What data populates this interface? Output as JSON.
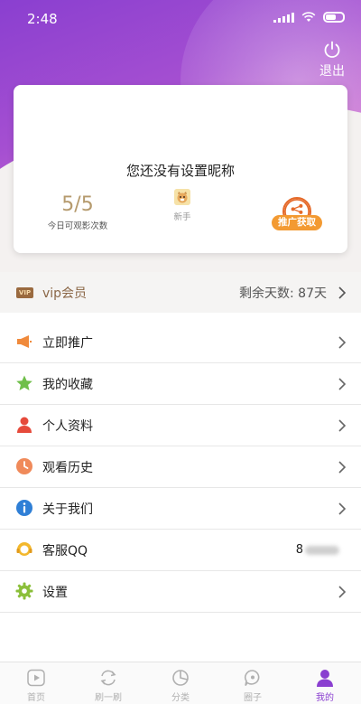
{
  "status": {
    "time": "2:48"
  },
  "header": {
    "logout_label": "退出"
  },
  "profile": {
    "nickname": "您还没有设置昵称",
    "quota_value": "5/5",
    "quota_label": "今日可观影次数",
    "level_label": "新手",
    "promo_label": "推广获取"
  },
  "vip": {
    "label": "vip会员",
    "days_label": "剩余天数: 87天",
    "icon_text": "VIP"
  },
  "menu": [
    {
      "label": "立即推广",
      "icon": "megaphone-icon",
      "color": "#f08a3c"
    },
    {
      "label": "我的收藏",
      "icon": "star-icon",
      "color": "#6fbf4a"
    },
    {
      "label": "个人资料",
      "icon": "person-icon",
      "color": "#e64a3b"
    },
    {
      "label": "观看历史",
      "icon": "clock-icon",
      "color": "#f08a5a"
    },
    {
      "label": "关于我们",
      "icon": "info-icon",
      "color": "#2f7fd6"
    },
    {
      "label": "客服QQ",
      "icon": "headset-icon",
      "color": "#f3b82d",
      "value": "8"
    },
    {
      "label": "设置",
      "icon": "gear-icon",
      "color": "#8bbf3a"
    }
  ],
  "tabs": [
    {
      "label": "首页",
      "icon": "play-icon"
    },
    {
      "label": "刷一刷",
      "icon": "refresh-icon"
    },
    {
      "label": "分类",
      "icon": "pie-icon"
    },
    {
      "label": "圈子",
      "icon": "chat-icon"
    },
    {
      "label": "我的",
      "icon": "user-icon",
      "active": true
    }
  ],
  "colors": {
    "accent": "#8a3fd0",
    "gold": "#b59a6d",
    "promo": "#f39a32"
  }
}
